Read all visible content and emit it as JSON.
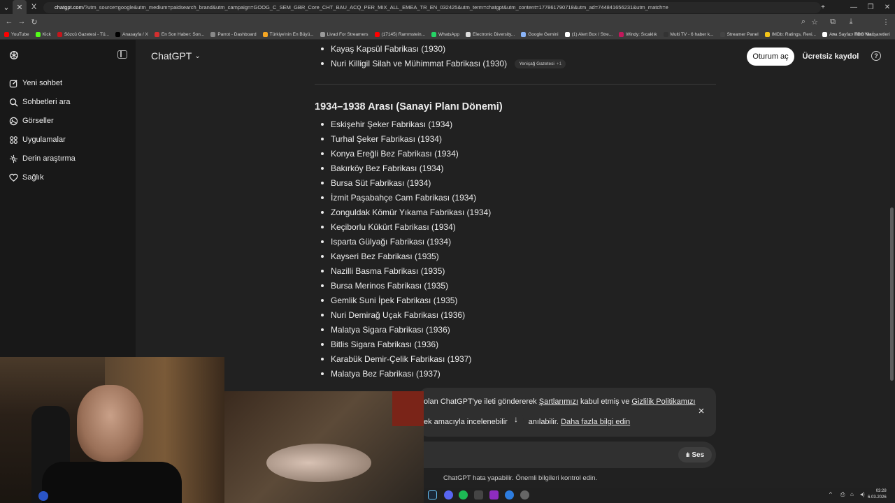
{
  "browser": {
    "tab_glyph": "X",
    "url_host": "chatgpt.com",
    "url_rest": "/?utm_source=google&utm_medium=paidsearch_brand&utm_campaign=GOOG_C_SEM_GBR_Core_CHT_BAU_ACQ_PER_MIX_ALL_EMEA_TR_EN_032425&utm_term=chatgpt&utm_content=177861790718&utm_ad=744841656231&utm_match=e",
    "bookmarks": [
      {
        "label": "YouTube",
        "color": "#ff0000"
      },
      {
        "label": "Kick",
        "color": "#53fc18"
      },
      {
        "label": "Sözcü Gazetesi - Tü...",
        "color": "#c4161c"
      },
      {
        "label": "Anasayfa / X",
        "color": "#000000"
      },
      {
        "label": "En Son Haber: Son...",
        "color": "#d32f2f"
      },
      {
        "label": "Parrot - Dashboard",
        "color": "#888888"
      },
      {
        "label": "Türkiye'nin En Büyü...",
        "color": "#f5a623"
      },
      {
        "label": "Livad For Streamers",
        "color": "#999999"
      },
      {
        "label": "(17145) Rammstein...",
        "color": "#ff0000"
      },
      {
        "label": "WhatsApp",
        "color": "#25d366"
      },
      {
        "label": "Electronic Diversity...",
        "color": "#dddddd"
      },
      {
        "label": "Google Gemini",
        "color": "#8ab4f8"
      },
      {
        "label": "(1) Alert Box / Stre...",
        "color": "#ffffff"
      },
      {
        "label": "Windy: Sıcaklık",
        "color": "#c2185b"
      },
      {
        "label": "Multi TV - 6 haber k...",
        "color": "#333333"
      },
      {
        "label": "Streamer Panel",
        "color": "#444444"
      },
      {
        "label": "IMDb: Ratings, Revi...",
        "color": "#f5c518"
      },
      {
        "label": "Ana Sayfa • HBO Max",
        "color": "#ffffff"
      }
    ],
    "bookmarks_other": "Tüm Yer İşaretleri"
  },
  "sidebar": {
    "items": [
      {
        "label": "Yeni sohbet",
        "icon": "edit-icon"
      },
      {
        "label": "Sohbetleri ara",
        "icon": "search-icon"
      },
      {
        "label": "Görseller",
        "icon": "image-icon"
      },
      {
        "label": "Uygulamalar",
        "icon": "apps-icon"
      },
      {
        "label": "Derin araştırma",
        "icon": "research-icon"
      },
      {
        "label": "Sağlık",
        "icon": "heart-icon"
      }
    ]
  },
  "header": {
    "model": "ChatGPT",
    "login": "Oturum aç",
    "signup": "Ücretsiz kaydol",
    "help": "?"
  },
  "content": {
    "prev_items": [
      "Kayaş Kapsül Fabrikası (1930)",
      "Nuri Killigil Silah ve Mühimmat Fabrikası (1930)"
    ],
    "citation": {
      "source": "Yeniçağ Gazetesi",
      "more": "+1"
    },
    "heading": "1934–1938 Arası (Sanayi Planı Dönemi)",
    "items": [
      "Eskişehir Şeker Fabrikası (1934)",
      "Turhal Şeker Fabrikası (1934)",
      "Konya Ereğli Bez Fabrikası (1934)",
      "Bakırköy Bez Fabrikası (1934)",
      "Bursa Süt Fabrikası (1934)",
      "İzmit Paşabahçe Cam Fabrikası (1934)",
      "Zonguldak Kömür Yıkama Fabrikası (1934)",
      "Keçiborlu Kükürt Fabrikası (1934)",
      "Isparta Gülyağı Fabrikası (1934)",
      "Kayseri Bez Fabrikası (1935)",
      "Nazilli Basma Fabrikası (1935)",
      "Bursa Merinos Fabrikası (1935)",
      "Gemlik Suni İpek Fabrikası (1935)",
      "Nuri Demirağ Uçak Fabrikası (1936)",
      "Malatya Sigara Fabrikası (1936)",
      "Bitlis Sigara Fabrikası (1936)",
      "Karabük Demir-Çelik Fabrikası (1937)",
      "Malatya Bez Fabrikası (1937)"
    ]
  },
  "banner": {
    "line1_prefix": "olan ChatGPT'ye ileti göndererek ",
    "terms_link": "Şartlarımızı",
    "line1_mid": " kabul etmiş ve ",
    "privacy_link": "Gizlilik Politikamızı",
    "line2_prefix": "ek amacıyla incelenebilir ve ",
    "line2_mid": "anılabilir. ",
    "more_link": "Daha fazla bilgi edin",
    "close": "×"
  },
  "composer": {
    "voice_label": "Ses"
  },
  "disclaimer": "ChatGPT hata yapabilir. Önemli bilgileri kontrol edin.",
  "taskbar": {
    "time": "03:28",
    "date": "6.03.2026"
  }
}
